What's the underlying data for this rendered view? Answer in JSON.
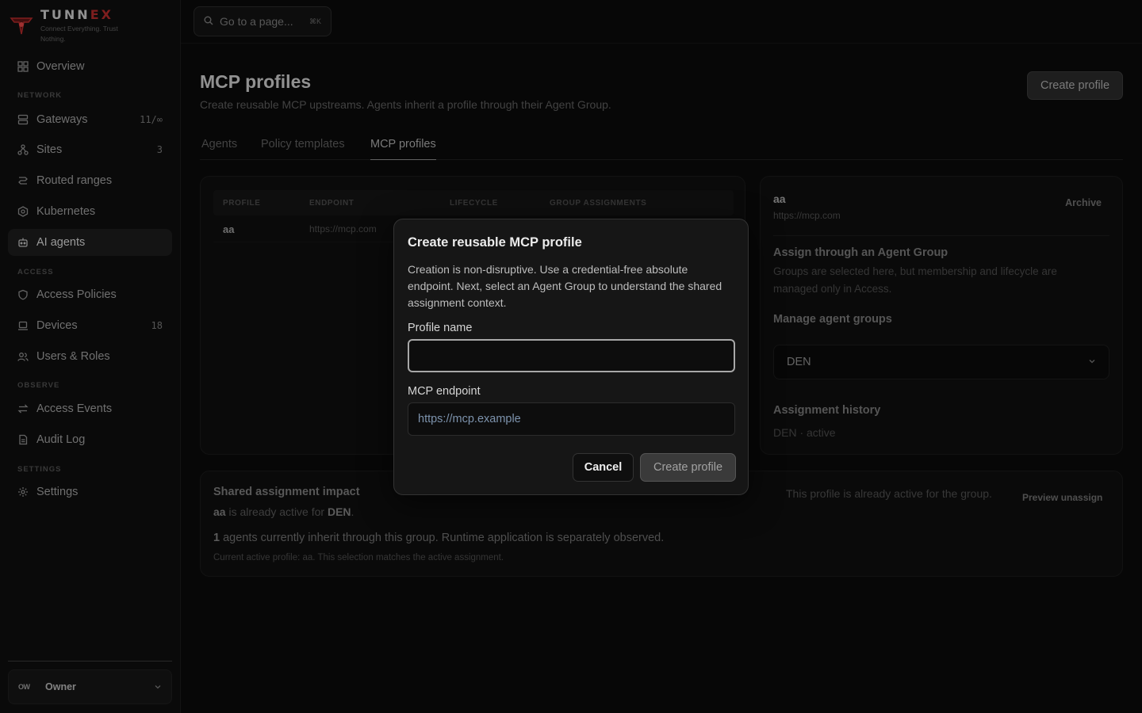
{
  "brand": {
    "name_main": "TUNN",
    "name_accent": "EX",
    "tagline": "Connect Everything. Trust Nothing."
  },
  "search": {
    "placeholder": "Go to a page...",
    "shortcut": "⌘K"
  },
  "sidebar": {
    "overview": "Overview",
    "sections": {
      "network": "NETWORK",
      "access": "ACCESS",
      "observe": "OBSERVE",
      "settings": "SETTINGS"
    },
    "items": [
      {
        "label": "Gateways",
        "count": "11/∞"
      },
      {
        "label": "Sites",
        "count": "3"
      },
      {
        "label": "Routed ranges",
        "count": ""
      },
      {
        "label": "Kubernetes",
        "count": ""
      },
      {
        "label": "AI agents",
        "count": ""
      },
      {
        "label": "Access Policies",
        "count": ""
      },
      {
        "label": "Devices",
        "count": "18"
      },
      {
        "label": "Users & Roles",
        "count": ""
      },
      {
        "label": "Access Events",
        "count": ""
      },
      {
        "label": "Audit Log",
        "count": ""
      },
      {
        "label": "Settings",
        "count": ""
      }
    ],
    "user": {
      "initials": "OW",
      "role": "Owner"
    }
  },
  "page": {
    "title": "MCP profiles",
    "subtitle": "Create reusable MCP upstreams. Agents inherit a profile through their Agent Group.",
    "create_button": "Create profile",
    "tabs": [
      "Agents",
      "Policy templates",
      "MCP profiles"
    ]
  },
  "table": {
    "headers": [
      "PROFILE",
      "ENDPOINT",
      "LIFECYCLE",
      "GROUP ASSIGNMENTS"
    ],
    "rows": [
      {
        "profile": "aa",
        "endpoint": "https://mcp.com"
      }
    ]
  },
  "detail": {
    "name": "aa",
    "url": "https://mcp.com",
    "archive": "Archive",
    "assign_heading": "Assign through an Agent Group",
    "assign_desc": "Groups are selected here, but membership and lifecycle are managed only in Access.",
    "manage_heading": "Manage agent groups",
    "selected_group": "DEN",
    "history_heading": "Assignment history",
    "history_item": "DEN · active"
  },
  "impact": {
    "heading": "Shared assignment impact",
    "line1_profile": "aa",
    "line1_mid": " is already active for ",
    "line1_group": "DEN",
    "line1_end": ".",
    "line2_count": "1",
    "line2_text": " agents currently inherit through this group. Runtime application is separately observed.",
    "line3": "Current active profile: aa. This selection matches the active assignment.",
    "right_text": "This profile is already active for the group.",
    "preview_link": "Preview unassign"
  },
  "modal": {
    "title": "Create reusable MCP profile",
    "description": "Creation is non-disruptive. Use a credential-free absolute endpoint. Next, select an Agent Group to understand the shared assignment context.",
    "name_label": "Profile name",
    "name_value": "",
    "endpoint_label": "MCP endpoint",
    "endpoint_placeholder": "https://mcp.example",
    "cancel": "Cancel",
    "create": "Create profile"
  },
  "colors": {
    "brand_red": "#b02a2a",
    "background": "#0a0a0a",
    "modal_bg": "#161616"
  }
}
